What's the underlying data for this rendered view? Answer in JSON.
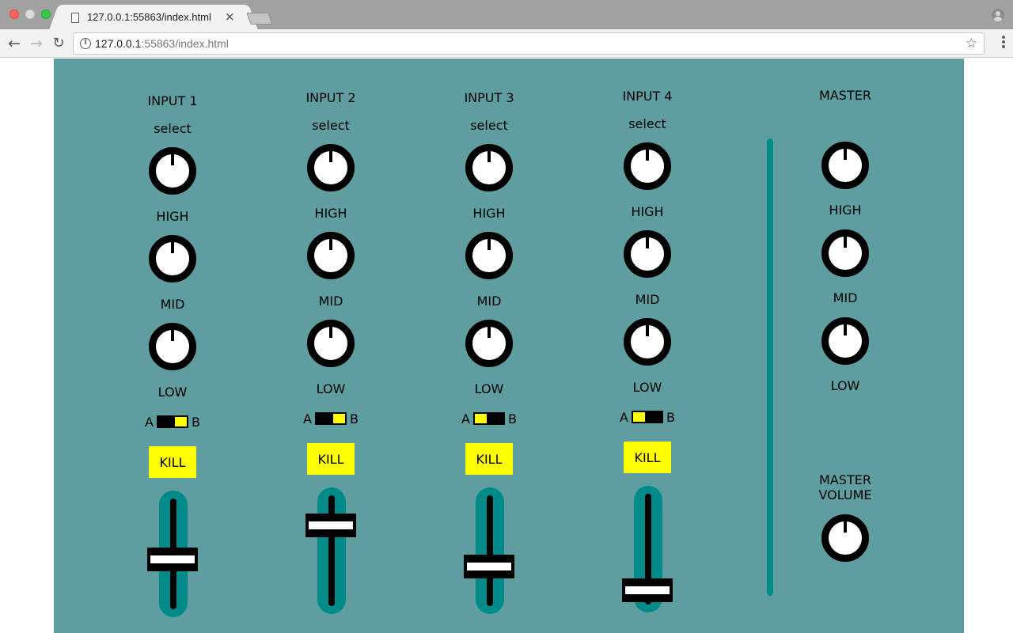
{
  "browser": {
    "tab_title": "127.0.0.1:55863/index.html",
    "tab_close": "×",
    "url_host": "127.0.0.1",
    "url_rest": ":55863/index.html",
    "back": "←",
    "forward": "→",
    "reload": "↻",
    "star": "☆",
    "info": "i"
  },
  "channels": [
    {
      "name": "INPUT 1",
      "select": "select",
      "high": "HIGH",
      "mid": "MID",
      "low": "LOW",
      "a": "A",
      "b": "B",
      "ab_position": "B",
      "kill": "KILL",
      "fader_level": 0.45
    },
    {
      "name": "INPUT 2",
      "select": "select",
      "high": "HIGH",
      "mid": "MID",
      "low": "LOW",
      "a": "A",
      "b": "B",
      "ab_position": "B",
      "kill": "KILL",
      "fader_level": 0.75
    },
    {
      "name": "INPUT 3",
      "select": "select",
      "high": "HIGH",
      "mid": "MID",
      "low": "LOW",
      "a": "A",
      "b": "B",
      "ab_position": "A",
      "kill": "KILL",
      "fader_level": 0.35
    },
    {
      "name": "INPUT 4",
      "select": "select",
      "high": "HIGH",
      "mid": "MID",
      "low": "LOW",
      "a": "A",
      "b": "B",
      "ab_position": "A",
      "kill": "KILL",
      "fader_level": 0.1
    }
  ],
  "master": {
    "title": "MASTER",
    "high": "HIGH",
    "mid": "MID",
    "low": "LOW",
    "volume_line1": "MASTER",
    "volume_line2": "VOLUME"
  },
  "colors": {
    "background": "#5f9ea0",
    "track": "#008b8b",
    "accent": "#ffff00"
  }
}
